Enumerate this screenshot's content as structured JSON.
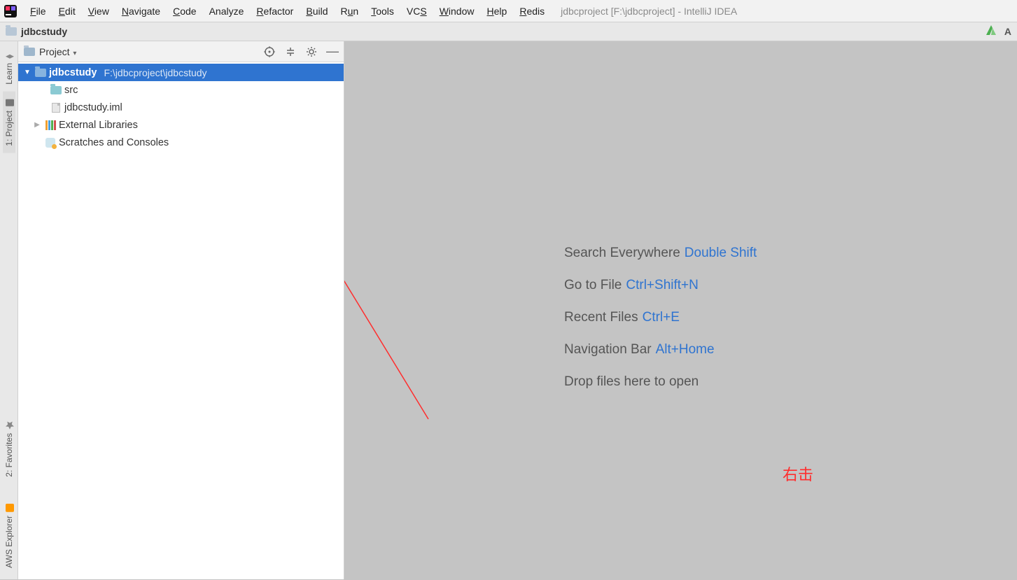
{
  "window_title": "jdbcproject [F:\\jdbcproject] - IntelliJ IDEA",
  "menu": {
    "file": "File",
    "edit": "Edit",
    "view": "View",
    "navigate": "Navigate",
    "code": "Code",
    "analyze": "Analyze",
    "refactor": "Refactor",
    "build": "Build",
    "run": "Run",
    "tools": "Tools",
    "vcs": "VCS",
    "window": "Window",
    "help": "Help",
    "redis": "Redis"
  },
  "breadcrumb": {
    "root": "jdbcstudy"
  },
  "left_tabs": {
    "learn": "Learn",
    "project": "1: Project",
    "favorites": "2: Favorites",
    "aws": "AWS Explorer"
  },
  "project_pane": {
    "title": "Project",
    "tree": {
      "root_name": "jdbcstudy",
      "root_path": "F:\\jdbcproject\\jdbcstudy",
      "src": "src",
      "iml": "jdbcstudy.iml",
      "external": "External Libraries",
      "scratches": "Scratches and Consoles"
    }
  },
  "hints": {
    "search_label": "Search Everywhere",
    "search_key": "Double Shift",
    "goto_label": "Go to File",
    "goto_key": "Ctrl+Shift+N",
    "recent_label": "Recent Files",
    "recent_key": "Ctrl+E",
    "navbar_label": "Navigation Bar",
    "navbar_key": "Alt+Home",
    "drop": "Drop files here to open"
  },
  "annotation": {
    "text": "右击"
  }
}
